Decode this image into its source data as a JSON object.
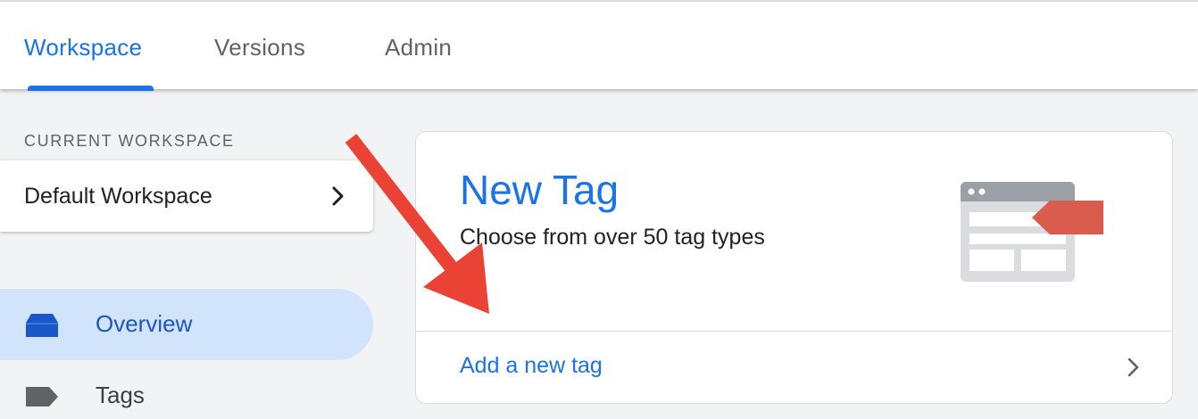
{
  "tabs": [
    {
      "label": "Workspace",
      "active": true
    },
    {
      "label": "Versions",
      "active": false
    },
    {
      "label": "Admin",
      "active": false
    }
  ],
  "sidebar": {
    "workspace_heading": "CURRENT WORKSPACE",
    "workspace_name": "Default Workspace",
    "workspace_icon": "chevron-right-icon",
    "nav_items": [
      {
        "label": "Overview",
        "icon": "overview-icon",
        "active": true
      },
      {
        "label": "Tags",
        "icon": "tag-icon",
        "active": false
      }
    ]
  },
  "card": {
    "title": "New Tag",
    "subtitle": "Choose from over 50 tag types",
    "illustration": "tag-browser-illustration",
    "action_label": "Add a new tag",
    "action_icon": "chevron-right-icon"
  },
  "annotation": {
    "type": "arrow",
    "color": "#ea4335",
    "points_to": "card.action_label"
  },
  "colors": {
    "accent": "#1a73e8",
    "nav_active_bg": "#d2e3fc",
    "page_bg": "#f1f3f4",
    "tag_red": "#d95c4f"
  }
}
